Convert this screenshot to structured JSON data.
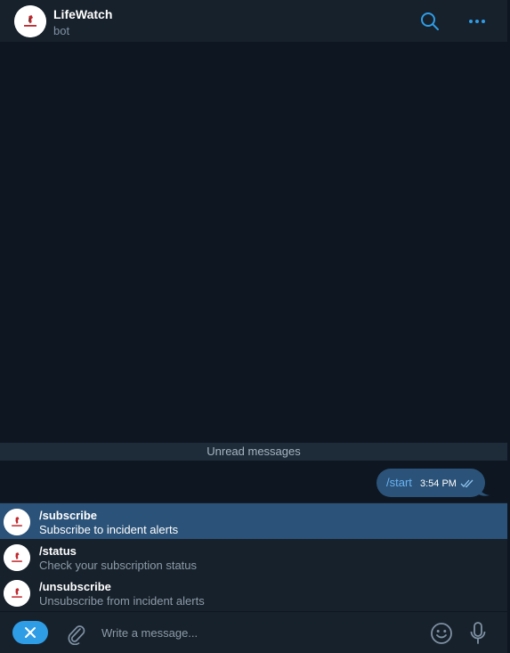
{
  "header": {
    "title": "LifeWatch",
    "subtitle": "bot",
    "avatar_icon": "lifewatch-logo-icon",
    "icons": [
      "search-icon",
      "more-icon"
    ]
  },
  "chat": {
    "unread_label": "Unread messages",
    "messages": [
      {
        "text": "/start",
        "time": "3:54 PM",
        "status_icon": "double-check-icon"
      }
    ]
  },
  "suggestions": [
    {
      "command": "/subscribe",
      "description": "Subscribe to incident alerts",
      "selected": true
    },
    {
      "command": "/status",
      "description": "Check your subscription status",
      "selected": false
    },
    {
      "command": "/unsubscribe",
      "description": "Unsubscribe from incident alerts",
      "selected": false
    }
  ],
  "composer": {
    "placeholder": "Write a message...",
    "icons": [
      "close-icon",
      "paperclip-icon",
      "emoji-icon",
      "microphone-icon"
    ]
  },
  "colors": {
    "accent": "#2f9de6",
    "outgoing_bubble": "#2b5278",
    "chat_background": "#0e1621",
    "panel": "#17212b"
  }
}
